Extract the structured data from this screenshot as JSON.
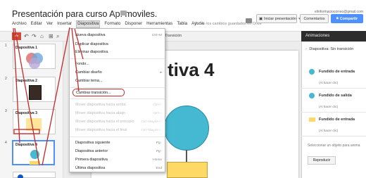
{
  "header": {
    "doc_title": "Presentación para curso Ap. moviles.",
    "email": "elinformaciocorreo@gmail.com",
    "saved_status": "Todos los cambios guardados en Drive",
    "start_button": "Iniciar presentación",
    "comments_button": "Comentarios",
    "share_button": "Compartir"
  },
  "menubar": [
    "Archivo",
    "Editar",
    "Ver",
    "Insertar",
    "Diapositiva",
    "Formato",
    "Disponer",
    "Herramientas",
    "Tabla",
    "Ayuda"
  ],
  "toolbar": {
    "add_label": "+",
    "transition_label": "Transición"
  },
  "slides": [
    {
      "num": "1",
      "title": "Diapositiva 1"
    },
    {
      "num": "2",
      "title": "Diapositiva 2"
    },
    {
      "num": "3",
      "title": "Diapositiva 3"
    },
    {
      "num": "4",
      "title": "Diapositiva 4"
    }
  ],
  "canvas": {
    "title": "tiva 4"
  },
  "menu": {
    "items": [
      {
        "label": "Nueva diapositiva",
        "shortcut": "Ctrl+M"
      },
      {
        "label": "Duplicar diapositiva",
        "shortcut": ""
      },
      {
        "label": "Eliminar diapositiva",
        "shortcut": ""
      },
      {
        "label": "Fondo...",
        "shortcut": ""
      },
      {
        "label": "Cambiar diseño",
        "shortcut": "▸"
      },
      {
        "label": "Cambiar tema...",
        "shortcut": ""
      },
      {
        "label": "Cambiar transición...",
        "shortcut": ""
      },
      {
        "label": "Mover diapositiva hacia arriba",
        "shortcut": "Ctrl+↑"
      },
      {
        "label": "Mover diapositiva hacia abajo",
        "shortcut": "Ctrl+↓"
      },
      {
        "label": "Mover diapositiva hacia el principio",
        "shortcut": "Ctrl+Mayús+↑"
      },
      {
        "label": "Mover diapositiva hacia el final",
        "shortcut": "Ctrl+Mayús+↓"
      },
      {
        "label": "Diapositiva siguiente",
        "shortcut": "Pg↓"
      },
      {
        "label": "Diapositiva anterior",
        "shortcut": "Pg↑"
      },
      {
        "label": "Primera diapositiva",
        "shortcut": "Home"
      },
      {
        "label": "Última diapositiva",
        "shortcut": "End"
      }
    ]
  },
  "panel": {
    "title": "Animaciones",
    "slide_transition": "Diapositiva: Sin transición",
    "animations": [
      {
        "label": "Fundido de entrada",
        "trigger": "(Al hacer clic)"
      },
      {
        "label": "Fundido de salida",
        "trigger": "(Al hacer clic)"
      },
      {
        "label": "Fundido de entrada",
        "trigger": "(Al hacer clic)"
      }
    ],
    "hint": "Seleccionar un objeto para anima",
    "play_button": "Reproducir"
  },
  "colors": {
    "accent_blue": "#4d90fe",
    "add_red": "#d14836",
    "annotation_red": "#c62828",
    "shape_cyan": "#45b8d2",
    "shape_yellow": "#ffd966"
  }
}
